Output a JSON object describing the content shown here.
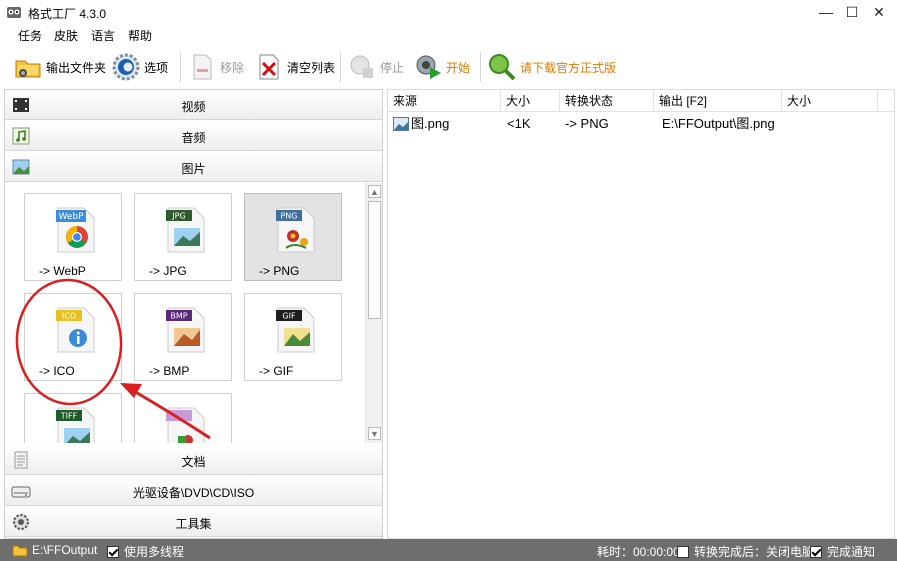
{
  "window": {
    "title": "格式工厂 4.3.0",
    "minimize_glyph": "—",
    "maximize_glyph": "☐",
    "close_glyph": "✕"
  },
  "menu": [
    "任务",
    "皮肤",
    "语言",
    "帮助"
  ],
  "toolbar": {
    "output_folder": "输出文件夹",
    "options": "选项",
    "remove": "移除",
    "clear_list": "清空列表",
    "stop": "停止",
    "start": "开始",
    "download": "请下载官方正式版"
  },
  "categories": {
    "video": "视频",
    "audio": "音频",
    "image": "图片",
    "document": "文档",
    "optical": "光驱设备\\DVD\\CD\\ISO",
    "tools": "工具集"
  },
  "tiles": [
    {
      "badge": "WebP",
      "label": "-> WebP",
      "badge_color": "#3d8ad8"
    },
    {
      "badge": "JPG",
      "label": "-> JPG",
      "badge_color": "#2e5a2e"
    },
    {
      "badge": "PNG",
      "label": "-> PNG",
      "badge_color": "#3f6f9e"
    },
    {
      "badge": "ICO",
      "label": "-> ICO",
      "badge_color": "#e8c020"
    },
    {
      "badge": "BMP",
      "label": "-> BMP",
      "badge_color": "#5a2a7a"
    },
    {
      "badge": "GIF",
      "label": "-> GIF",
      "badge_color": "#1e1e1e"
    },
    {
      "badge": "TIFF",
      "label": "",
      "badge_color": "#1f5a2a"
    },
    {
      "badge": "",
      "label": "",
      "badge_color": "#c99ad8"
    }
  ],
  "list": {
    "columns": [
      "来源",
      "大小",
      "转换状态",
      "输出 [F2]",
      "大小"
    ],
    "rows": [
      {
        "source": "图.png",
        "size": "<1K",
        "status": "-> PNG",
        "output": "E:\\FFOutput\\图.png",
        "out_size": ""
      }
    ]
  },
  "status": {
    "output_path": "E:\\FFOutput",
    "multithread": "使用多线程",
    "elapsed": "耗时：00:00:00",
    "after_done": "转换完成后：关闭电脑",
    "notify": "完成通知"
  },
  "colors": {
    "annotation_red": "#d92020",
    "statusbar_bg": "#6e6e6e",
    "download_orange": "#e07a00"
  }
}
